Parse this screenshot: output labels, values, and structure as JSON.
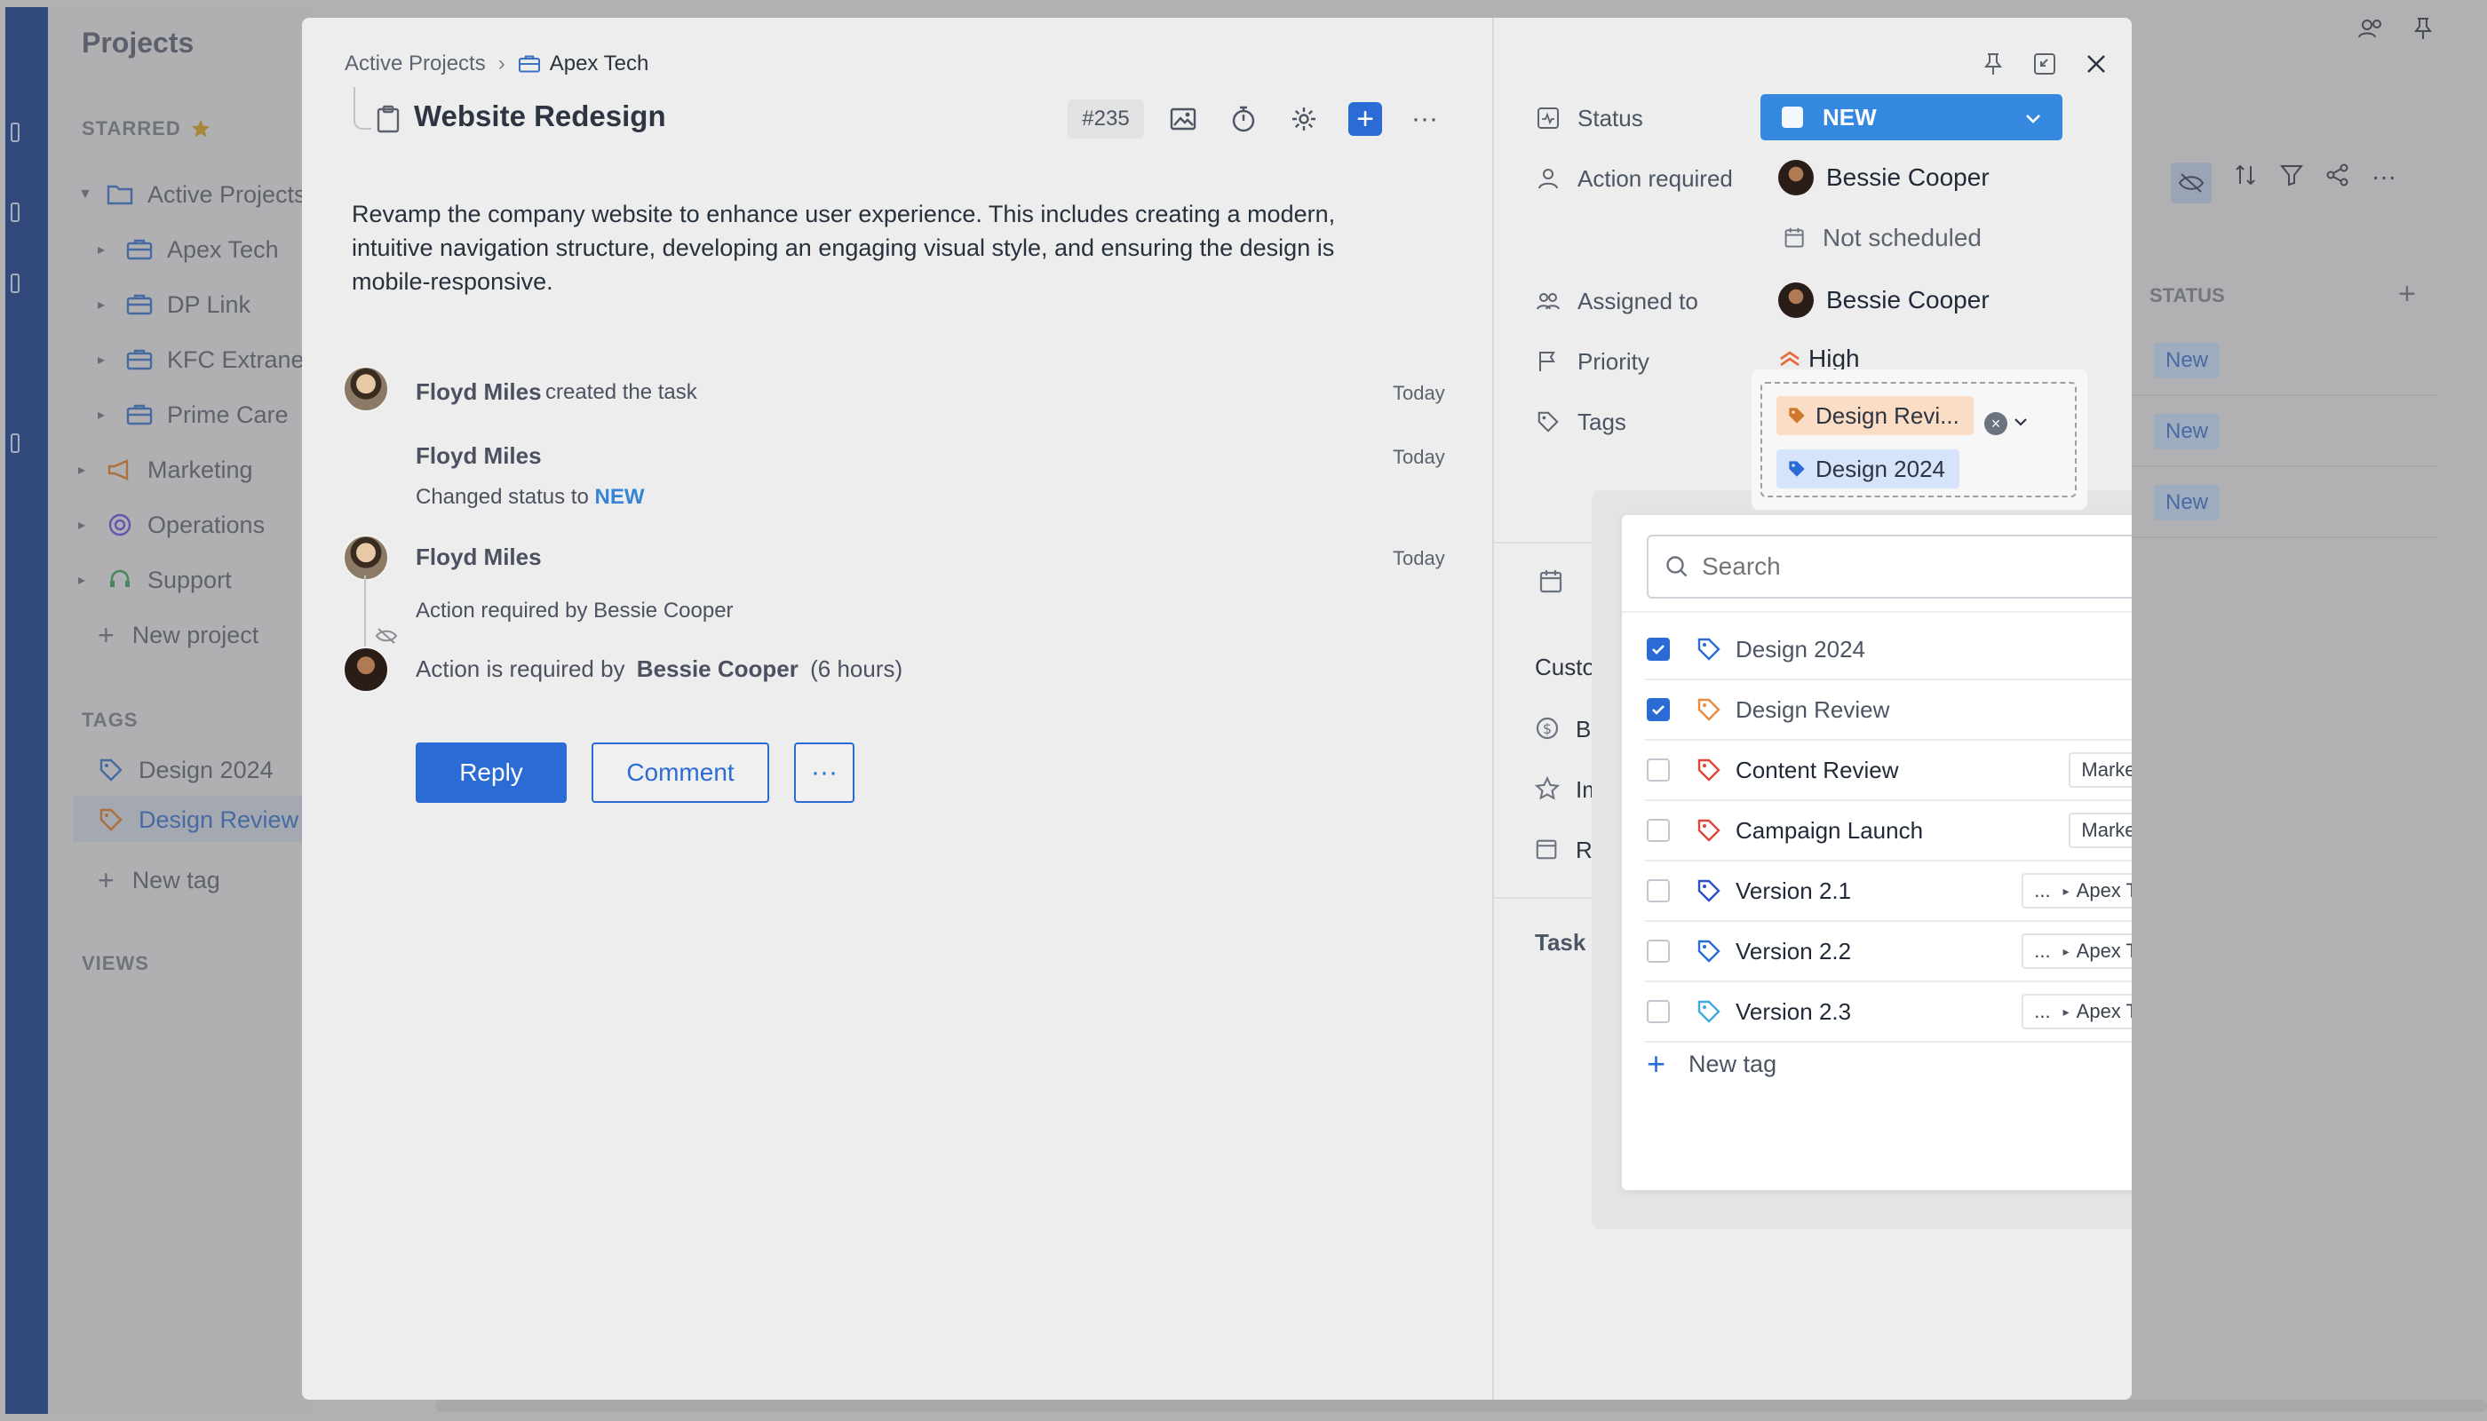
{
  "sidebar": {
    "title": "Projects",
    "starred_label": "STARRED",
    "projects": [
      {
        "label": "Active Projects",
        "level": 0,
        "expanded": true
      },
      {
        "label": "Apex Tech",
        "level": 1
      },
      {
        "label": "DP Link",
        "level": 1
      },
      {
        "label": "KFC Extranet",
        "level": 1
      },
      {
        "label": "Prime Care",
        "level": 1
      },
      {
        "label": "Marketing",
        "level": 0
      },
      {
        "label": "Operations",
        "level": 0
      },
      {
        "label": "Support",
        "level": 0
      }
    ],
    "new_project": "New project",
    "tags_label": "TAGS",
    "tags": [
      "Design 2024",
      "Design Review"
    ],
    "new_tag": "New tag",
    "views_label": "VIEWS"
  },
  "background": {
    "status_header": "STATUS",
    "status_badges": [
      "New",
      "New",
      "New"
    ]
  },
  "task": {
    "breadcrumb": [
      "Active Projects",
      "Apex Tech"
    ],
    "title": "Website Redesign",
    "id": "#235",
    "description": "Revamp the company website to enhance user experience. This includes creating a modern, intuitive navigation structure, developing an engaging visual style, and ensuring the design is mobile-responsive.",
    "activity": {
      "a1_name": "Floyd Miles",
      "a1_text": "created the task",
      "a1_time": "Today",
      "a2_name": "Floyd Miles",
      "a2_prefix": "Changed status to",
      "a2_status": "NEW",
      "a2_time": "Today",
      "a3_name": "Floyd Miles",
      "a3_text": "Action required by Bessie Cooper",
      "a3_time": "Today",
      "a4_prefix": "Action is required by",
      "a4_name": "Bessie Cooper",
      "a4_suffix": "(6 hours)"
    },
    "buttons": {
      "reply": "Reply",
      "comment": "Comment",
      "more": "···"
    }
  },
  "properties": {
    "status_label": "Status",
    "status_value": "NEW",
    "action_label": "Action required",
    "action_value": "Bessie Cooper",
    "schedule_value": "Not scheduled",
    "assigned_label": "Assigned to",
    "assigned_value": "Bessie Cooper",
    "priority_label": "Priority",
    "priority_value": "High",
    "tags_label": "Tags",
    "selected_tags": [
      "Design Revi...",
      "Design 2024"
    ],
    "custom_label": "Custom",
    "budget_label": "Budg",
    "importance_label": "Impo",
    "review_label": "Revi",
    "task_use_label": "Task use"
  },
  "tag_dropdown": {
    "search_placeholder": "Search",
    "items": [
      {
        "label": "Design 2024",
        "checked": true,
        "color": "#2b6bd6",
        "scope": ""
      },
      {
        "label": "Design Review",
        "checked": true,
        "color": "#ea8a3a",
        "scope": ""
      },
      {
        "label": "Content Review",
        "checked": false,
        "color": "#e0463a",
        "scope": "Marketing"
      },
      {
        "label": "Campaign Launch",
        "checked": false,
        "color": "#e0463a",
        "scope": "Marketing"
      },
      {
        "label": "Version 2.1",
        "checked": false,
        "color": "#2b4fc9",
        "scope": "Apex Tech"
      },
      {
        "label": "Version 2.2",
        "checked": false,
        "color": "#2b6bd6",
        "scope": "Apex Tech"
      },
      {
        "label": "Version 2.3",
        "checked": false,
        "color": "#3fa8e0",
        "scope": "Apex Tech"
      }
    ],
    "scope_ellipsis": "...",
    "new_tag": "New tag"
  },
  "colors": {
    "accent": "#2b6bd6",
    "status_blue": "#3488e0",
    "priority_orange": "#e86a3a"
  }
}
